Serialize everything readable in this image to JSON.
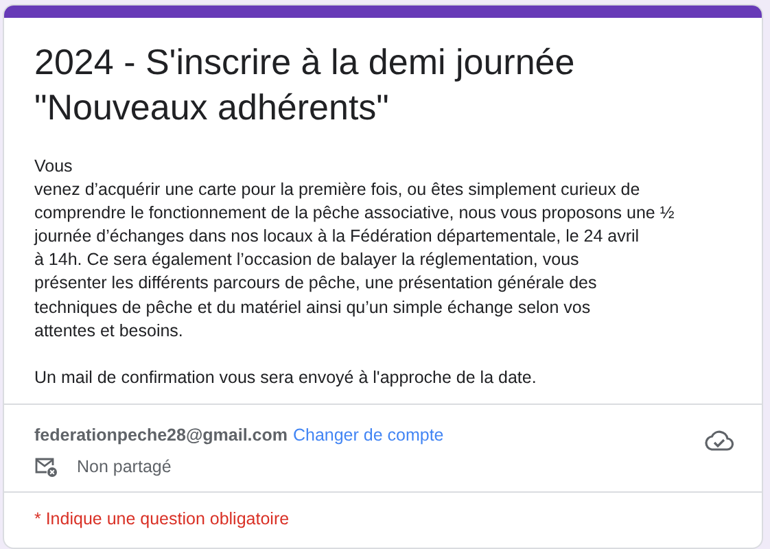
{
  "form": {
    "title": "2024 - S'inscrire à la demi journée \"Nouveaux adhérents\"",
    "description": [
      "Vous\nvenez d’acquérir une carte pour la première fois, ou êtes simplement curieux de\ncomprendre le fonctionnement de la pêche associative, nous vous proposons une ½\njournée d’échanges dans nos locaux à la Fédération départementale, le 24 avril\nà 14h. Ce sera également l’occasion de balayer la réglementation, vous\nprésenter les différents parcours de pêche, une présentation générale des\ntechniques de pêche et du matériel ainsi qu’un simple échange selon vos\nattentes et besoins.",
      "Un mail de confirmation vous sera envoyé à l'approche de la date."
    ]
  },
  "account": {
    "email": "federationpeche28@gmail.com",
    "switch_link": "Changer de compte",
    "sharing": "Non partagé"
  },
  "required_note": "* Indique une question obligatoire"
}
